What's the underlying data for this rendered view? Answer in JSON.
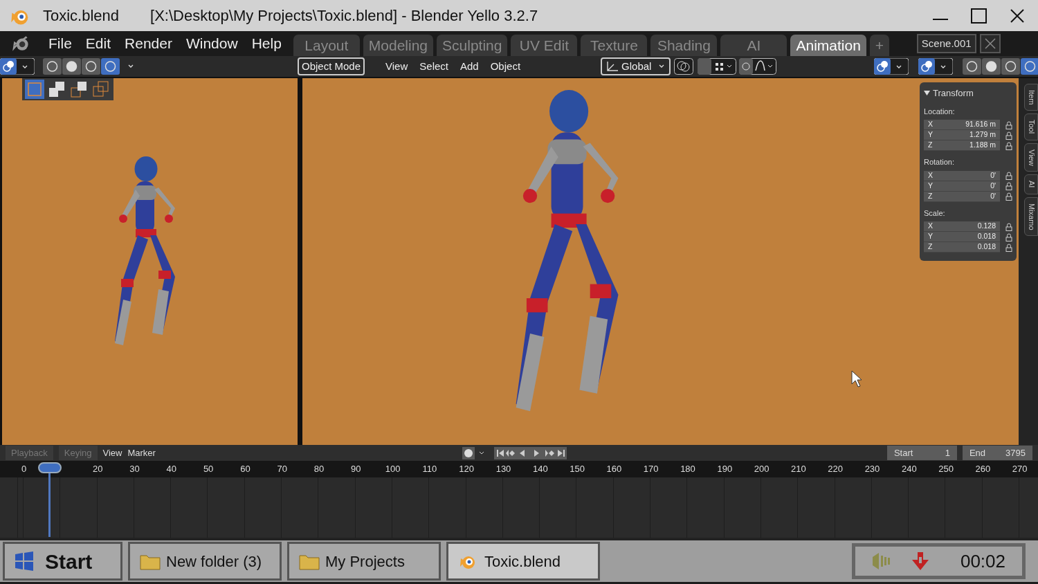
{
  "window": {
    "title": "Toxic.blend",
    "caption": "[X:\\Desktop\\My Projects\\Toxic.blend] - Blender Yello 3.2.7"
  },
  "menu": [
    "File",
    "Edit",
    "Render",
    "Window",
    "Help"
  ],
  "workspaces": [
    {
      "label": "Layout",
      "selected": false
    },
    {
      "label": "Modeling",
      "selected": false
    },
    {
      "label": "Sculpting",
      "selected": false
    },
    {
      "label": "UV Edit",
      "selected": false
    },
    {
      "label": "Texture",
      "selected": false
    },
    {
      "label": "Shading",
      "selected": false
    },
    {
      "label": "AI",
      "selected": false
    },
    {
      "label": "Animation",
      "selected": true
    }
  ],
  "add_workspace": "+",
  "scene": "Scene.001",
  "header": {
    "mode": "Object Mode",
    "menus": [
      "View",
      "Select",
      "Add",
      "Object"
    ],
    "orientation": "Global"
  },
  "sidebar": {
    "title": "Transform",
    "expanded": true,
    "groups": [
      {
        "label": "Location:",
        "fields": [
          {
            "axis": "X",
            "value": "91.616 m"
          },
          {
            "axis": "Y",
            "value": "1.279 m"
          },
          {
            "axis": "Z",
            "value": "1.188 m"
          }
        ]
      },
      {
        "label": "Rotation:",
        "fields": [
          {
            "axis": "X",
            "value": "0'"
          },
          {
            "axis": "Y",
            "value": "0'"
          },
          {
            "axis": "Z",
            "value": "0'"
          }
        ]
      },
      {
        "label": "Scale:",
        "fields": [
          {
            "axis": "X",
            "value": "0.128"
          },
          {
            "axis": "Y",
            "value": "0.018"
          },
          {
            "axis": "Z",
            "value": "0.018"
          }
        ]
      }
    ],
    "tabs": [
      "Item",
      "Tool",
      "View",
      "AI",
      "Mixamo"
    ]
  },
  "timeline": {
    "tabs": [
      "Playback",
      "Keying"
    ],
    "menus": [
      "View",
      "Marker"
    ],
    "start_label": "Start",
    "start": "1",
    "end_label": "End",
    "end": "3795",
    "ticks": [
      "0",
      "20",
      "30",
      "40",
      "50",
      "60",
      "70",
      "80",
      "90",
      "100",
      "110",
      "120",
      "130",
      "140",
      "150",
      "160",
      "170",
      "180",
      "190",
      "200",
      "210",
      "220",
      "230",
      "240",
      "250",
      "260",
      "270"
    ]
  },
  "taskbar": {
    "start": "Start",
    "tasks": [
      {
        "label": "New folder (3)",
        "kind": "folder",
        "selected": false
      },
      {
        "label": "My Projects",
        "kind": "folder",
        "selected": false
      },
      {
        "label": "Toxic.blend",
        "kind": "blender",
        "selected": true
      }
    ],
    "clock": "00:02"
  }
}
